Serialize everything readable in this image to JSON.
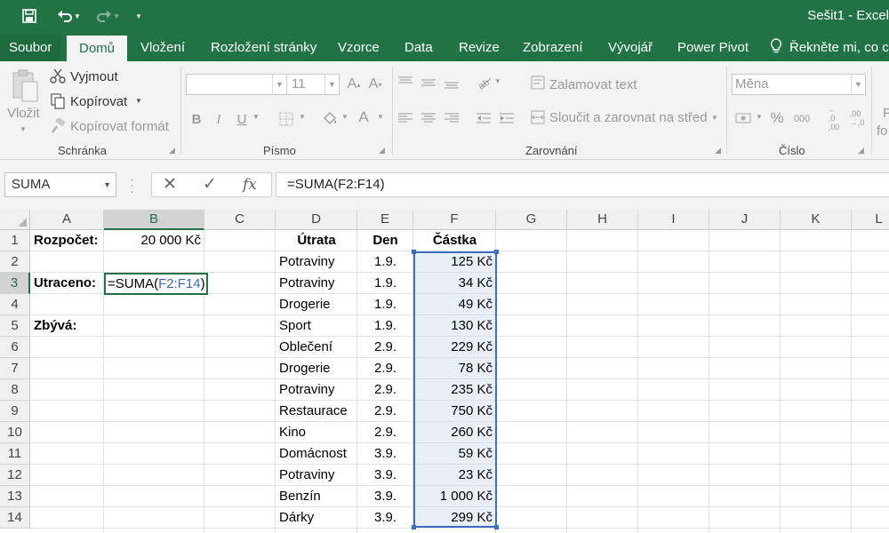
{
  "app": {
    "title": "Sešit1 - Excel",
    "accent": "#217346",
    "range_highlight": "#3c6fc2"
  },
  "quick_access": {
    "icons": [
      "save-icon",
      "undo-icon",
      "redo-icon",
      "customize-icon"
    ]
  },
  "menu": {
    "tabs": [
      "Soubor",
      "Domů",
      "Vložení",
      "Rozložení stránky",
      "Vzorce",
      "Data",
      "Revize",
      "Zobrazení",
      "Vývojář",
      "Power Pivot"
    ],
    "active": "Domů",
    "tell_me": "Řekněte mi, co ch"
  },
  "ribbon": {
    "clipboard": {
      "paste": "Vložit",
      "cut": "Vyjmout",
      "copy": "Kopírovat",
      "format_painter": "Kopírovat formát",
      "label": "Schránka"
    },
    "font": {
      "size": "11",
      "label": "Písmo"
    },
    "alignment": {
      "wrap": "Zalamovat text",
      "merge": "Sloučit a zarovnat na střed",
      "label": "Zarovnání"
    },
    "number": {
      "format": "Měna",
      "label": "Číslo",
      "percent": "%",
      "thousands": "000"
    },
    "styles": {
      "partial_top": "P",
      "partial_bottom": "fo"
    }
  },
  "formula_bar": {
    "name_box": "SUMA",
    "formula": "=SUMA(F2:F14)",
    "fx": "fx"
  },
  "sheet": {
    "columns": [
      "A",
      "B",
      "C",
      "D",
      "E",
      "F",
      "G",
      "H",
      "I",
      "J",
      "K",
      "L"
    ],
    "rows": [
      "1",
      "2",
      "3",
      "4",
      "5",
      "6",
      "7",
      "8",
      "9",
      "10",
      "11",
      "12",
      "13",
      "14"
    ],
    "labels": {
      "budget": "Rozpočet:",
      "spent": "Utraceno:",
      "remaining": "Zbývá:"
    },
    "budget_value": "20 000 Kč",
    "edit_prefix": "=SUMA(",
    "edit_ref": "F2:F14",
    "edit_suffix": ")",
    "table_headers": [
      "Útrata",
      "Den",
      "Částka"
    ],
    "table_rows": [
      [
        "Potraviny",
        "1.9.",
        "125 Kč"
      ],
      [
        "Potraviny",
        "1.9.",
        "34 Kč"
      ],
      [
        "Drogerie",
        "1.9.",
        "49 Kč"
      ],
      [
        "Sport",
        "1.9.",
        "130 Kč"
      ],
      [
        "Oblečení",
        "2.9.",
        "229 Kč"
      ],
      [
        "Drogerie",
        "2.9.",
        "78 Kč"
      ],
      [
        "Potraviny",
        "2.9.",
        "235 Kč"
      ],
      [
        "Restaurace",
        "2.9.",
        "750 Kč"
      ],
      [
        "Kino",
        "2.9.",
        "260 Kč"
      ],
      [
        "Domácnost",
        "3.9.",
        "59 Kč"
      ],
      [
        "Potraviny",
        "3.9.",
        "23 Kč"
      ],
      [
        "Benzín",
        "3.9.",
        "1 000 Kč"
      ],
      [
        "Dárky",
        "3.9.",
        "299 Kč"
      ]
    ]
  }
}
